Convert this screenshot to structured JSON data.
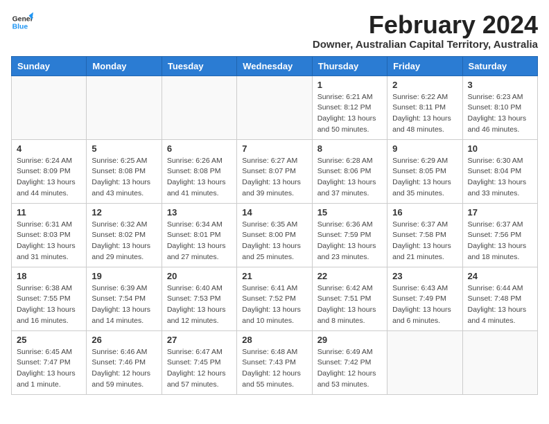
{
  "logo": {
    "general": "General",
    "blue": "Blue"
  },
  "header": {
    "title": "February 2024",
    "subtitle": "Downer, Australian Capital Territory, Australia"
  },
  "weekdays": [
    "Sunday",
    "Monday",
    "Tuesday",
    "Wednesday",
    "Thursday",
    "Friday",
    "Saturday"
  ],
  "weeks": [
    [
      {
        "day": "",
        "info": ""
      },
      {
        "day": "",
        "info": ""
      },
      {
        "day": "",
        "info": ""
      },
      {
        "day": "",
        "info": ""
      },
      {
        "day": "1",
        "info": "Sunrise: 6:21 AM\nSunset: 8:12 PM\nDaylight: 13 hours\nand 50 minutes."
      },
      {
        "day": "2",
        "info": "Sunrise: 6:22 AM\nSunset: 8:11 PM\nDaylight: 13 hours\nand 48 minutes."
      },
      {
        "day": "3",
        "info": "Sunrise: 6:23 AM\nSunset: 8:10 PM\nDaylight: 13 hours\nand 46 minutes."
      }
    ],
    [
      {
        "day": "4",
        "info": "Sunrise: 6:24 AM\nSunset: 8:09 PM\nDaylight: 13 hours\nand 44 minutes."
      },
      {
        "day": "5",
        "info": "Sunrise: 6:25 AM\nSunset: 8:08 PM\nDaylight: 13 hours\nand 43 minutes."
      },
      {
        "day": "6",
        "info": "Sunrise: 6:26 AM\nSunset: 8:08 PM\nDaylight: 13 hours\nand 41 minutes."
      },
      {
        "day": "7",
        "info": "Sunrise: 6:27 AM\nSunset: 8:07 PM\nDaylight: 13 hours\nand 39 minutes."
      },
      {
        "day": "8",
        "info": "Sunrise: 6:28 AM\nSunset: 8:06 PM\nDaylight: 13 hours\nand 37 minutes."
      },
      {
        "day": "9",
        "info": "Sunrise: 6:29 AM\nSunset: 8:05 PM\nDaylight: 13 hours\nand 35 minutes."
      },
      {
        "day": "10",
        "info": "Sunrise: 6:30 AM\nSunset: 8:04 PM\nDaylight: 13 hours\nand 33 minutes."
      }
    ],
    [
      {
        "day": "11",
        "info": "Sunrise: 6:31 AM\nSunset: 8:03 PM\nDaylight: 13 hours\nand 31 minutes."
      },
      {
        "day": "12",
        "info": "Sunrise: 6:32 AM\nSunset: 8:02 PM\nDaylight: 13 hours\nand 29 minutes."
      },
      {
        "day": "13",
        "info": "Sunrise: 6:34 AM\nSunset: 8:01 PM\nDaylight: 13 hours\nand 27 minutes."
      },
      {
        "day": "14",
        "info": "Sunrise: 6:35 AM\nSunset: 8:00 PM\nDaylight: 13 hours\nand 25 minutes."
      },
      {
        "day": "15",
        "info": "Sunrise: 6:36 AM\nSunset: 7:59 PM\nDaylight: 13 hours\nand 23 minutes."
      },
      {
        "day": "16",
        "info": "Sunrise: 6:37 AM\nSunset: 7:58 PM\nDaylight: 13 hours\nand 21 minutes."
      },
      {
        "day": "17",
        "info": "Sunrise: 6:37 AM\nSunset: 7:56 PM\nDaylight: 13 hours\nand 18 minutes."
      }
    ],
    [
      {
        "day": "18",
        "info": "Sunrise: 6:38 AM\nSunset: 7:55 PM\nDaylight: 13 hours\nand 16 minutes."
      },
      {
        "day": "19",
        "info": "Sunrise: 6:39 AM\nSunset: 7:54 PM\nDaylight: 13 hours\nand 14 minutes."
      },
      {
        "day": "20",
        "info": "Sunrise: 6:40 AM\nSunset: 7:53 PM\nDaylight: 13 hours\nand 12 minutes."
      },
      {
        "day": "21",
        "info": "Sunrise: 6:41 AM\nSunset: 7:52 PM\nDaylight: 13 hours\nand 10 minutes."
      },
      {
        "day": "22",
        "info": "Sunrise: 6:42 AM\nSunset: 7:51 PM\nDaylight: 13 hours\nand 8 minutes."
      },
      {
        "day": "23",
        "info": "Sunrise: 6:43 AM\nSunset: 7:49 PM\nDaylight: 13 hours\nand 6 minutes."
      },
      {
        "day": "24",
        "info": "Sunrise: 6:44 AM\nSunset: 7:48 PM\nDaylight: 13 hours\nand 4 minutes."
      }
    ],
    [
      {
        "day": "25",
        "info": "Sunrise: 6:45 AM\nSunset: 7:47 PM\nDaylight: 13 hours\nand 1 minute."
      },
      {
        "day": "26",
        "info": "Sunrise: 6:46 AM\nSunset: 7:46 PM\nDaylight: 12 hours\nand 59 minutes."
      },
      {
        "day": "27",
        "info": "Sunrise: 6:47 AM\nSunset: 7:45 PM\nDaylight: 12 hours\nand 57 minutes."
      },
      {
        "day": "28",
        "info": "Sunrise: 6:48 AM\nSunset: 7:43 PM\nDaylight: 12 hours\nand 55 minutes."
      },
      {
        "day": "29",
        "info": "Sunrise: 6:49 AM\nSunset: 7:42 PM\nDaylight: 12 hours\nand 53 minutes."
      },
      {
        "day": "",
        "info": ""
      },
      {
        "day": "",
        "info": ""
      }
    ]
  ]
}
